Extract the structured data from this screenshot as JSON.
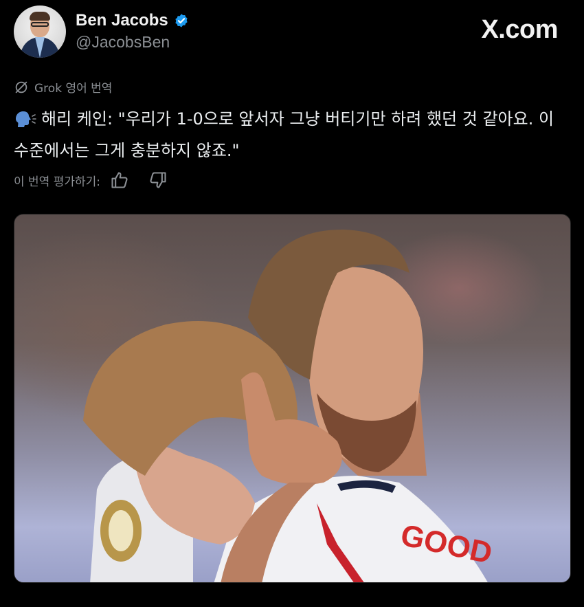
{
  "header": {
    "display_name": "Ben Jacobs",
    "handle": "@JacobsBen",
    "site_logo": "X.com",
    "avatar_icon": "profile-avatar",
    "verified_icon": "verified-badge-icon",
    "colors": {
      "verified": "#1d9bf0",
      "muted": "#8b8f94"
    }
  },
  "translation": {
    "label": "Grok 영어 번역",
    "icon": "grok-icon"
  },
  "tweet": {
    "icon": "speaking-head-icon",
    "text": "해리 케인: \"우리가 1-0으로 앞서자 그냥 버티기만 하려 했던 것 같아요. 이 수준에서는 그게 충분하지 않죠.\""
  },
  "rating": {
    "label": "이 번역 평가하기:",
    "icons": [
      "thumbs-up-icon",
      "thumbs-down-icon"
    ]
  },
  "media": {
    "type": "photo"
  }
}
